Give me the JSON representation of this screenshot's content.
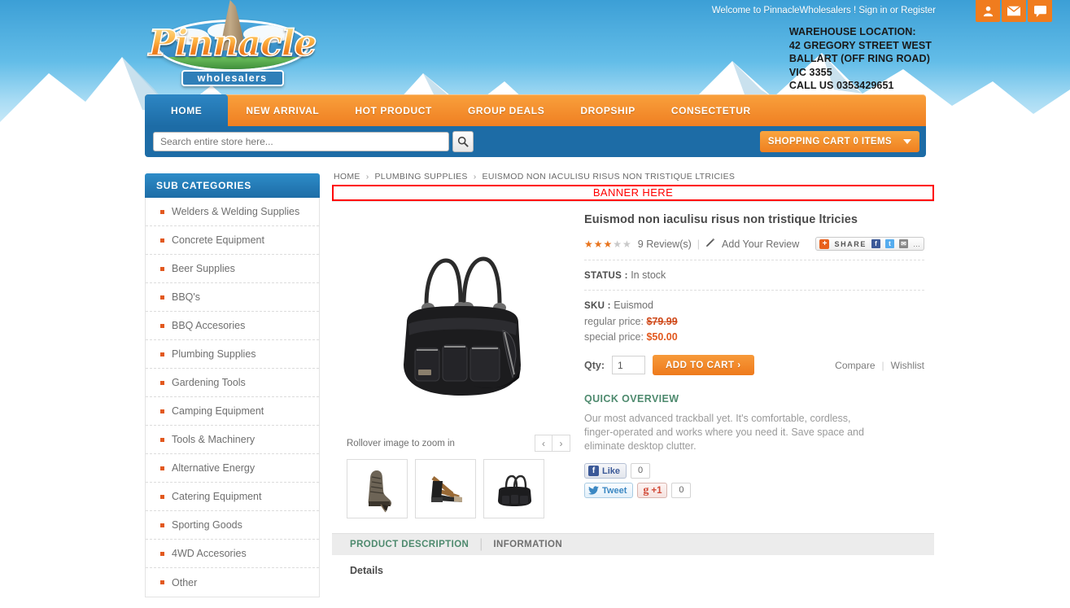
{
  "header": {
    "welcome_text": "Welcome to PinnacleWholesalers ! Sign in or Register",
    "icons": [
      "user-icon",
      "mail-icon",
      "chat-icon"
    ],
    "warehouse": {
      "line1": "WAREHOUSE LOCATION:",
      "line2": "42 GREGORY STREET WEST",
      "line3": "BALLART (OFF RING ROAD)",
      "line4": "VIC 3355",
      "line5": "CALL US 0353429651"
    },
    "logo": {
      "word": "Pinnacle",
      "sub": "wholesalers"
    }
  },
  "nav": {
    "items": [
      {
        "label": "HOME",
        "active": true
      },
      {
        "label": "NEW ARRIVAL",
        "active": false
      },
      {
        "label": "HOT PRODUCT",
        "active": false
      },
      {
        "label": "GROUP DEALS",
        "active": false
      },
      {
        "label": "DROPSHIP",
        "active": false
      },
      {
        "label": "CONSECTETUR",
        "active": false
      }
    ]
  },
  "search": {
    "placeholder": "Search entire store here...",
    "value": "",
    "button_icon": "search-icon"
  },
  "cart": {
    "label": "SHOPPING CART 0 ITEMS",
    "items": 0
  },
  "sidebar": {
    "title": "SUB CATEGORIES",
    "items": [
      {
        "label": "Welders & Welding Supplies"
      },
      {
        "label": "Concrete Equipment"
      },
      {
        "label": "Beer Supplies"
      },
      {
        "label": "BBQ's"
      },
      {
        "label": "BBQ Accesories"
      },
      {
        "label": "Plumbing Supplies"
      },
      {
        "label": "Gardening Tools"
      },
      {
        "label": "Camping Equipment"
      },
      {
        "label": "Tools & Machinery"
      },
      {
        "label": "Alternative Energy"
      },
      {
        "label": "Catering Equipment"
      },
      {
        "label": "Sporting Goods"
      },
      {
        "label": "4WD Accesories"
      },
      {
        "label": "Other"
      }
    ]
  },
  "breadcrumb": {
    "items": [
      "HOME",
      "PLUMBING SUPPLIES",
      "EUISMOD NON IACULISU RISUS NON TRISTIQUE LTRICIES"
    ],
    "separator": "›"
  },
  "banner": {
    "text": "BANNER HERE",
    "border_color": "#ff0000",
    "text_color": "#ff0000"
  },
  "product": {
    "title": "Euismod non iaculisu risus non tristique ltricies",
    "rating_filled": 3,
    "rating_total": 5,
    "reviews_label": "9 Review(s)",
    "add_review_label": "Add Your Review",
    "status_label": "STATUS :",
    "status_value": "In stock",
    "sku_label": "SKU :",
    "sku_value": "Euismod",
    "regular_price_label": "regular price:",
    "regular_price": "$79.99",
    "special_price_label": "special price:",
    "special_price": "$50.00",
    "qty_label": "Qty:",
    "qty_value": "1",
    "add_to_cart_label": "ADD TO CART ›",
    "compare_label": "Compare",
    "wishlist_label": "Wishlist",
    "quick_overview_title": "QUICK OVERVIEW",
    "quick_overview_text": "Our most advanced trackball yet. It's comfortable, cordless, finger-operated and works where you need it. Save space and eliminate desktop clutter.",
    "rollover_text": "Rollover image to zoom in",
    "prev_label": "‹",
    "next_label": "›",
    "main_image": "handbag-black",
    "thumbnails": [
      "boot-thumbnail",
      "sandal-thumbnail",
      "handbag-thumbnail"
    ]
  },
  "share": {
    "label": "SHARE",
    "plus": "+",
    "icons": [
      "facebook-icon",
      "twitter-icon",
      "email-icon",
      "more-icon"
    ]
  },
  "social": {
    "facebook_label": "Like",
    "facebook_count": "0",
    "twitter_label": "Tweet",
    "gplus_label": "+1",
    "gplus_count": "0"
  },
  "tabs": {
    "items": [
      {
        "label": "PRODUCT DESCRIPTION",
        "active": true
      },
      {
        "label": "INFORMATION",
        "active": false
      }
    ],
    "separator": "|",
    "content_heading": "Details"
  },
  "colors": {
    "orange": "#ef7f22",
    "blue": "#1d6ca6",
    "green": "#4e8a6e",
    "red": "#ff0000"
  }
}
